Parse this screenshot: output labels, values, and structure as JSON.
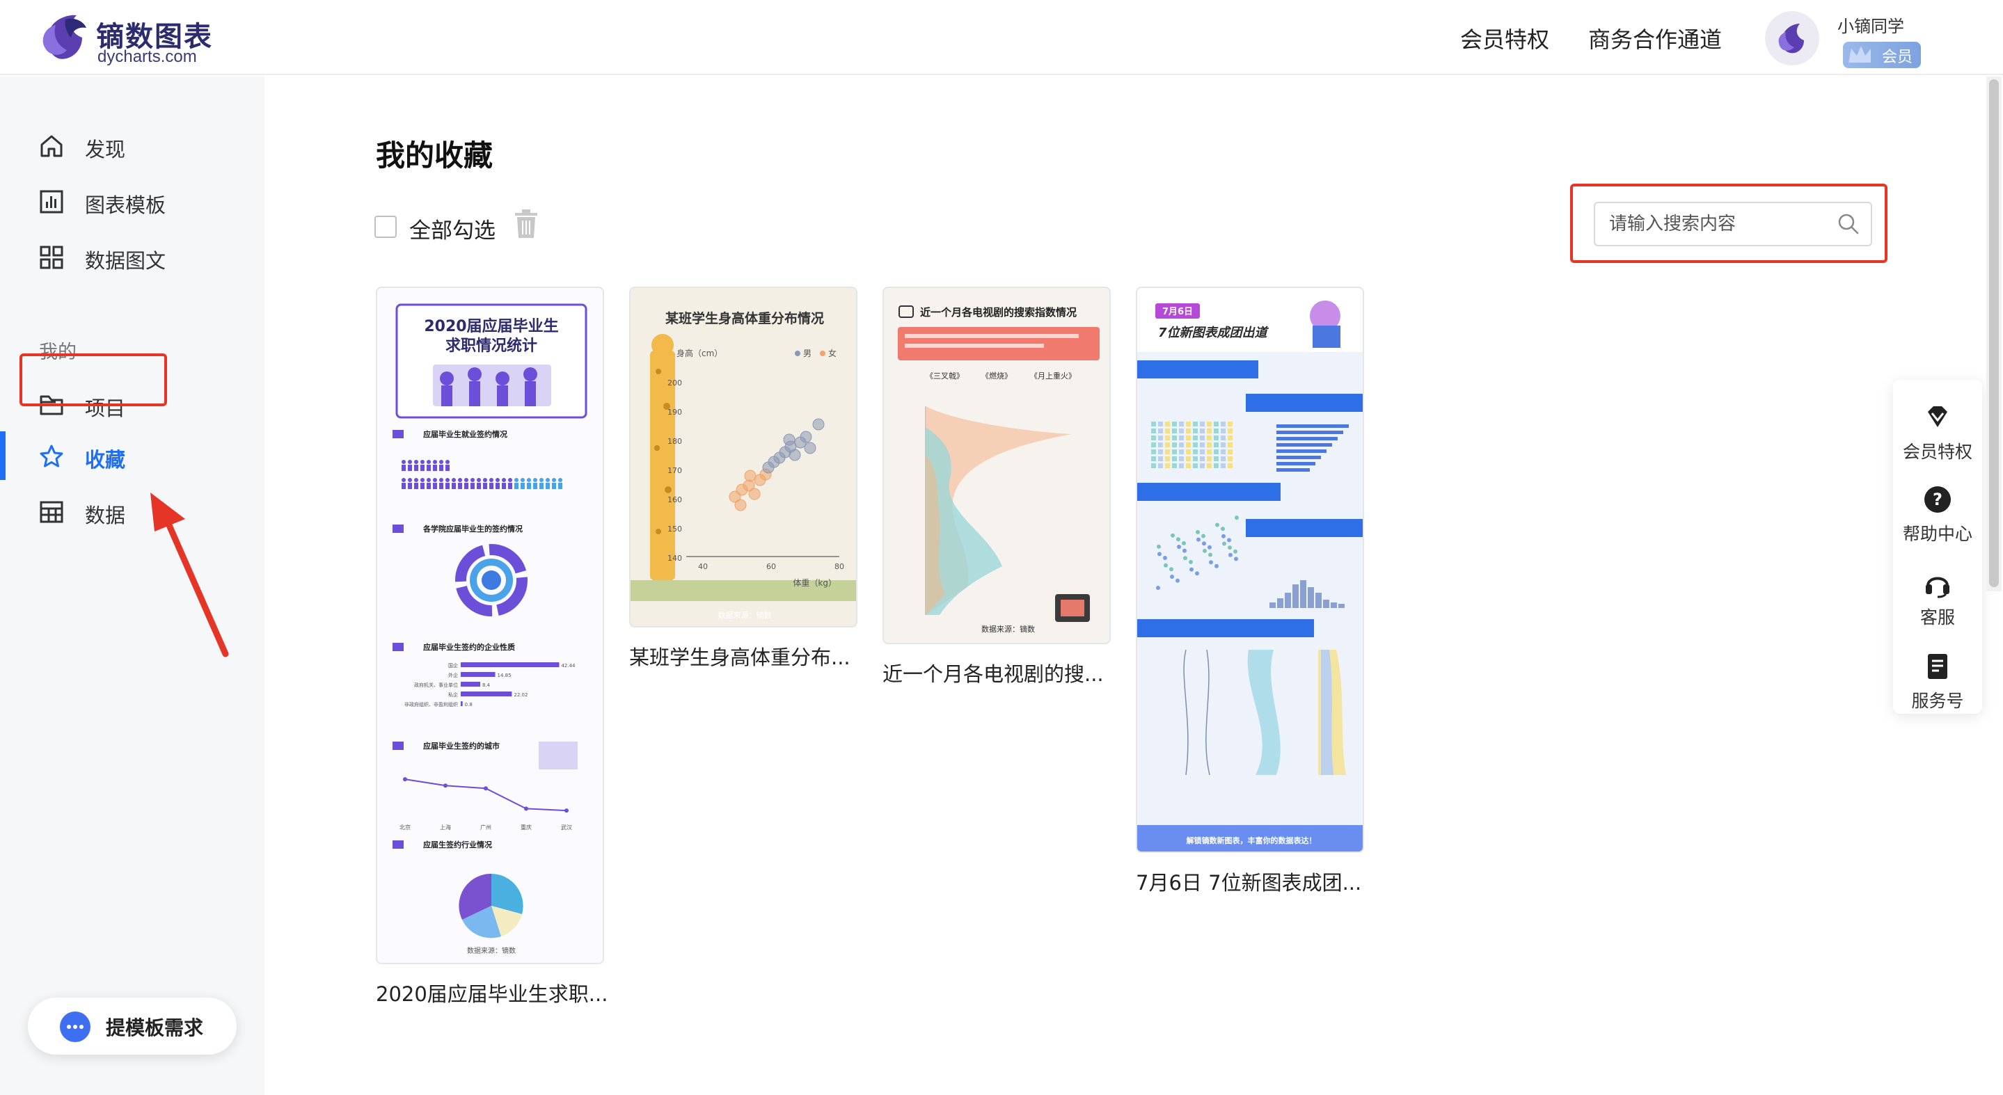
{
  "header": {
    "logo_title": "镝数图表",
    "logo_sub": "dycharts.com",
    "nav_vip": "会员特权",
    "nav_business": "商务合作通道",
    "user_name": "小镝同学",
    "vip_badge": "会员"
  },
  "sidebar": {
    "items": [
      {
        "label": "发现",
        "icon": "home-icon"
      },
      {
        "label": "图表模板",
        "icon": "chart-icon"
      },
      {
        "label": "数据图文",
        "icon": "grid-icon"
      }
    ],
    "section_mine": "我的",
    "mine_items": [
      {
        "label": "项目",
        "icon": "folder-icon"
      },
      {
        "label": "收藏",
        "icon": "star-icon",
        "active": true
      },
      {
        "label": "数据",
        "icon": "table-icon"
      }
    ],
    "request_button": "提模板需求"
  },
  "main": {
    "title": "我的收藏",
    "select_all": "全部勾选",
    "search_placeholder": "请输入搜索内容"
  },
  "cards": [
    {
      "title": "2020届应届毕业生求职...",
      "thumb_title_l1": "2020届应届毕业生",
      "thumb_title_l2": "求职情况统计",
      "sec1": "应届毕业生就业签约情况",
      "sec2": "各学院应届毕业生的签约情况",
      "sec3": "应届毕业生签约的企业性质",
      "sec4": "应届毕业生签约的城市",
      "sec5": "应届生签约行业情况",
      "source": "数据来源：镝数",
      "bar_labels": [
        "国企",
        "外企",
        "政府机关、事业单位",
        "私企",
        "非政府组织、非盈利组织"
      ],
      "bar_values": [
        42.44,
        14.85,
        8.4,
        22.02,
        0.8
      ],
      "city_labels": [
        "北京",
        "上海",
        "广州",
        "重庆",
        "武汉"
      ],
      "city_values": [
        38.5,
        32.0,
        29.1,
        8.3,
        6.3
      ]
    },
    {
      "title": "某班学生身高体重分布...",
      "thumb_title": "某班学生身高体重分布情况",
      "y_label": "身高（cm）",
      "x_label": "体重（kg）",
      "legend_male": "男",
      "legend_female": "女",
      "y_ticks": [
        "200",
        "190",
        "180",
        "170",
        "160",
        "150",
        "140"
      ],
      "x_ticks": [
        "40",
        "60",
        "80"
      ],
      "source": "数据来源：镝数"
    },
    {
      "title": "近一个月各电视剧的搜...",
      "thumb_title": "近一个月各电视剧的搜索指数情况",
      "legend": [
        "《三叉戟》",
        "《燃烧》",
        "《月上重火》"
      ],
      "source": "数据来源：镝数"
    },
    {
      "title": "7月6日 7位新图表成团...",
      "thumb_date": "7月6日",
      "thumb_title": "7位新图表成团出道",
      "footer": "解锁镝数新图表，丰富你的数据表达！"
    }
  ],
  "float_panel": [
    {
      "label": "会员特权",
      "icon": "diamond-icon"
    },
    {
      "label": "帮助中心",
      "icon": "help-icon"
    },
    {
      "label": "客服",
      "icon": "headset-icon"
    },
    {
      "label": "服务号",
      "icon": "document-icon"
    }
  ],
  "colors": {
    "accent": "#1e6ff1",
    "highlight": "#e53527",
    "purple": "#6b4fd8"
  }
}
